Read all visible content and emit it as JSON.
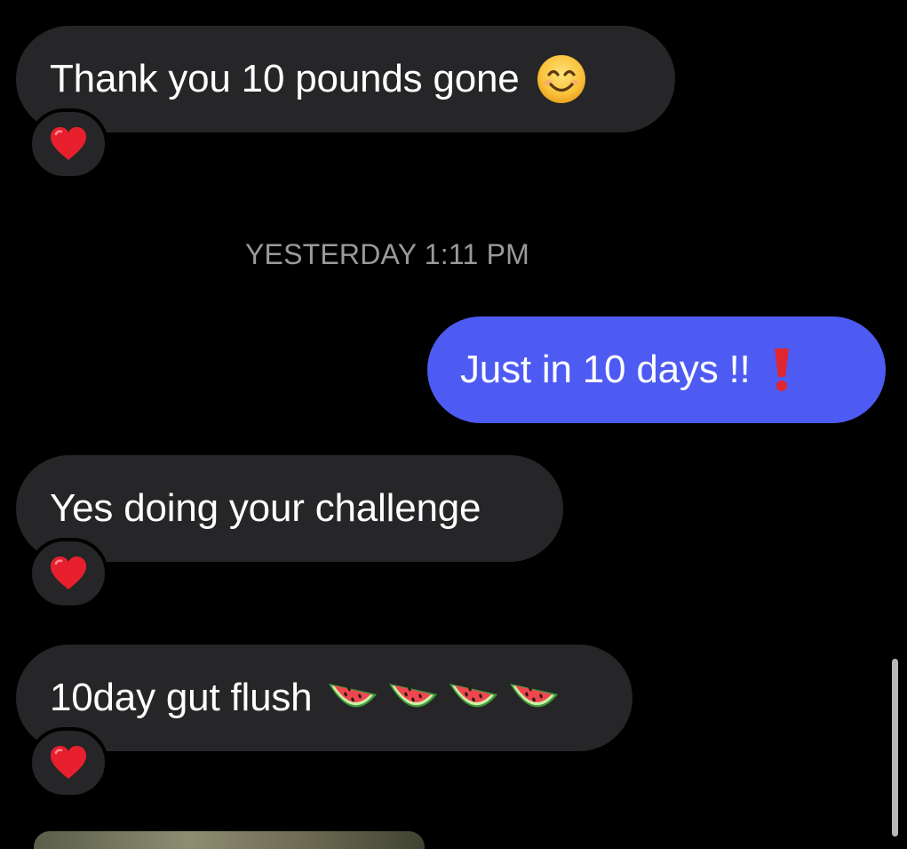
{
  "colors": {
    "background": "#000000",
    "received_bubble": "#262628",
    "sent_bubble": "#4D5BF2",
    "timestamp_text": "#9A9A9E",
    "message_text": "#FFFFFF"
  },
  "messages": [
    {
      "direction": "received",
      "text": "Thank you 10 pounds gone",
      "emoji": "smiling-face-icon",
      "reaction": "heart-icon"
    },
    {
      "direction": "sent",
      "text": "Just in 10 days !!",
      "emoji": "exclamation-icon"
    },
    {
      "direction": "received",
      "text": "Yes doing your challenge",
      "reaction": "heart-icon"
    },
    {
      "direction": "received",
      "text": "10day gut flush",
      "emoji": "watermelon-icon",
      "emoji_count": 4,
      "reaction": "heart-icon"
    }
  ],
  "timestamp": "YESTERDAY 1:11 PM"
}
